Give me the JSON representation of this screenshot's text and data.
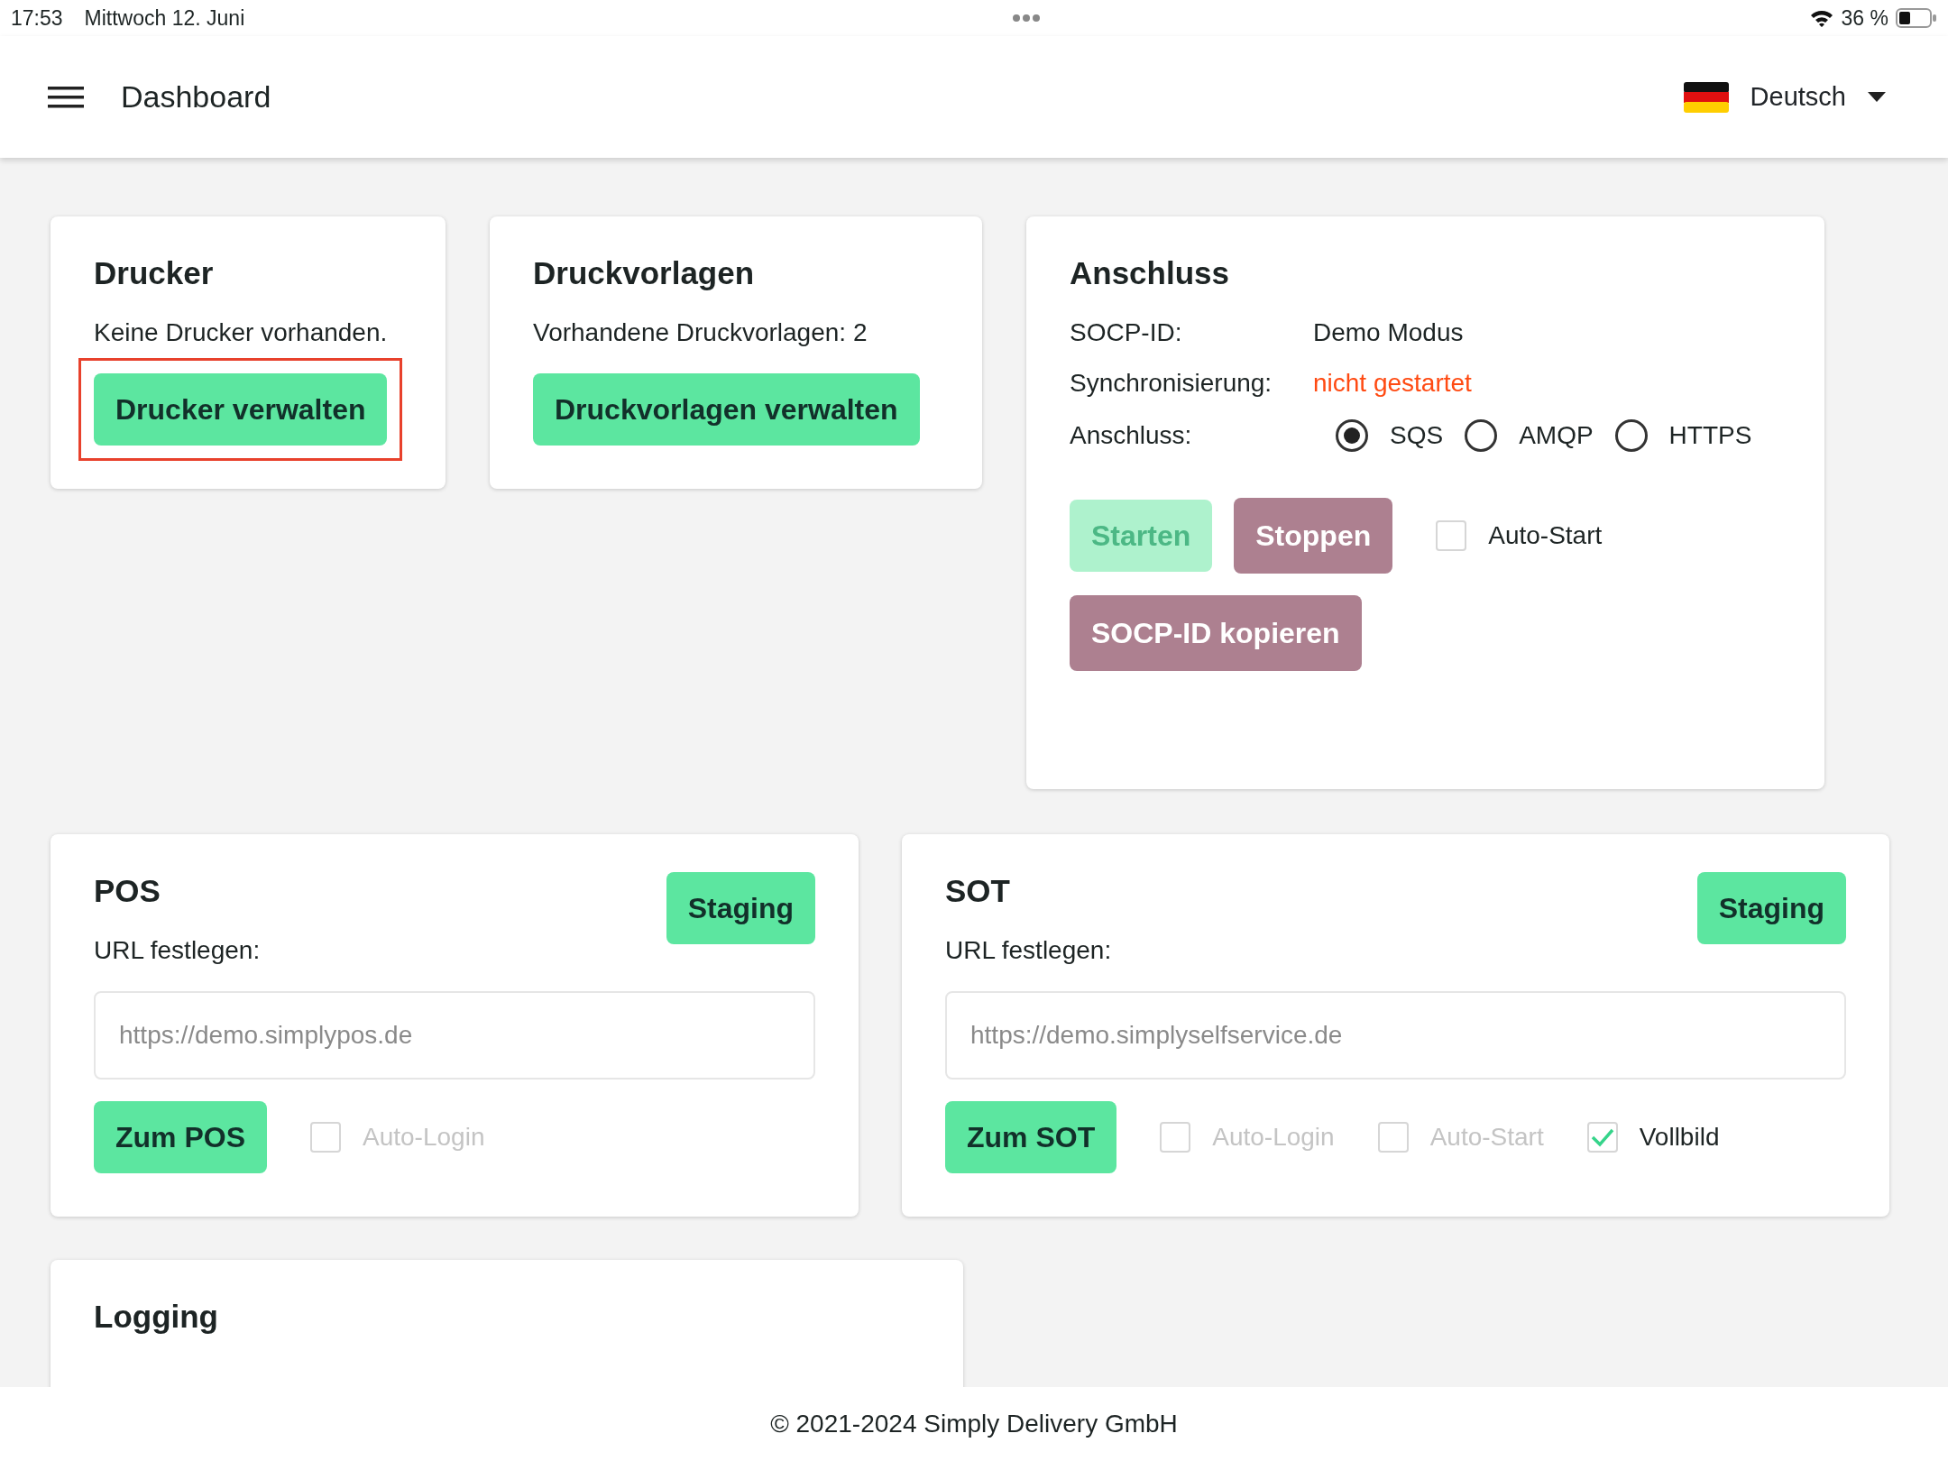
{
  "status_bar": {
    "time": "17:53",
    "date": "Mittwoch 12. Juni",
    "battery": "36 %"
  },
  "header": {
    "title": "Dashboard",
    "language": "Deutsch"
  },
  "printers": {
    "title": "Drucker",
    "text": "Keine Drucker vorhanden.",
    "button": {
      "label": "Drucker verwalten",
      "highlighted": true
    }
  },
  "templates": {
    "title": "Druckvorlagen",
    "text": "Vorhandene Druckvorlagen: 2",
    "button": {
      "label": "Druckvorlagen verwalten"
    }
  },
  "connection": {
    "title": "Anschluss",
    "fields": [
      {
        "label": "SOCP-ID:",
        "value": "Demo Modus",
        "kind": "plain"
      },
      {
        "label": "Synchronisierung:",
        "value": "nicht gestartet",
        "kind": "warning"
      }
    ],
    "transport": {
      "label": "Anschluss:",
      "options": [
        {
          "label": "SQS",
          "selected": true
        },
        {
          "label": "AMQP",
          "selected": false
        },
        {
          "label": "HTTPS",
          "selected": false
        }
      ]
    },
    "buttons": [
      {
        "label": "Starten",
        "kind": "primary",
        "disabled": true
      },
      {
        "label": "Stoppen",
        "kind": "secondary",
        "disabled": false
      }
    ],
    "auto_start": {
      "label": "Auto-Start",
      "checked": false,
      "disabled": false
    },
    "copy_button": {
      "label": "SOCP-ID kopieren",
      "kind": "secondary",
      "disabled": false
    }
  },
  "targets": [
    {
      "title": "POS",
      "env_button": "Staging",
      "url_label": "URL festlegen:",
      "placeholder": "https://demo.simplypos.de",
      "button": "Zum POS",
      "options": [
        {
          "label": "Auto-Login",
          "checked": false,
          "disabled": true
        }
      ]
    },
    {
      "title": "SOT",
      "env_button": "Staging",
      "url_label": "URL festlegen:",
      "placeholder": "https://demo.simplyselfservice.de",
      "button": "Zum SOT",
      "options": [
        {
          "label": "Auto-Login",
          "checked": false,
          "disabled": true
        },
        {
          "label": "Auto-Start",
          "checked": false,
          "disabled": true
        },
        {
          "label": "Vollbild",
          "checked": true,
          "disabled": false
        }
      ]
    }
  ],
  "logging": {
    "title": "Logging"
  },
  "footer": "© 2021-2024 Simply Delivery GmbH"
}
